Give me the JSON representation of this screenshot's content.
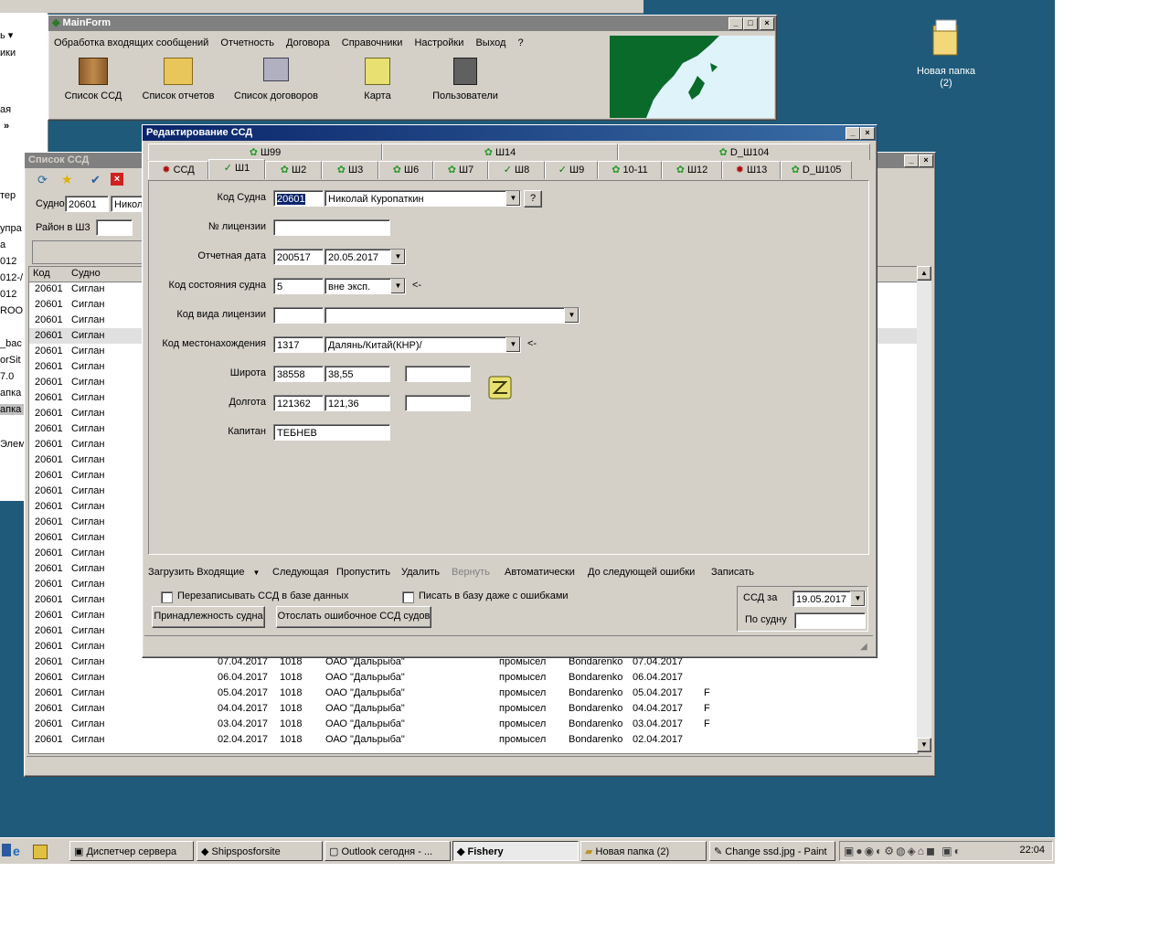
{
  "desktop": {
    "folder_label": "Новая папка (2)"
  },
  "bg_window": {
    "left_fragments": [
      "ь ▾",
      "ики",
      "ая",
      "»",
      "тер",
      "упра",
      "а",
      "012",
      "012-/",
      "012",
      "ROO",
      "_bac",
      "orSit",
      "7.0",
      "апка",
      "апка",
      "Элем"
    ]
  },
  "mainform": {
    "title": "MainForm",
    "menu": [
      "Обработка входящих сообщений",
      "Отчетность",
      "Договора",
      "Справочники",
      "Настройки",
      "Выход",
      "?"
    ],
    "toolbar": [
      {
        "label": "Список ССД",
        "icon": "books-icon"
      },
      {
        "label": "Список отчетов",
        "icon": "folder-icon"
      },
      {
        "label": "Список договоров",
        "icon": "printer-icon"
      },
      {
        "label": "Карта",
        "icon": "map-scroll-icon"
      },
      {
        "label": "Пользователи",
        "icon": "notebook-icon"
      }
    ]
  },
  "ssd_list": {
    "title": "Список ССД",
    "sudno_label": "Судно",
    "sudno_code": "20601",
    "sudno_name": "Никол",
    "rayon_label": "Район в Ш3",
    "columns": [
      "Код",
      "Судно"
    ],
    "rows": [
      {
        "code": "20601",
        "name": "Сиглан",
        "date": "",
        "n": "",
        "org": "",
        "type": "",
        "user": "",
        "date2": "",
        "flag": ""
      },
      {
        "code": "20601",
        "name": "Сиглан",
        "date": "",
        "n": "",
        "org": "",
        "type": "",
        "user": "",
        "date2": "",
        "flag": ""
      },
      {
        "code": "20601",
        "name": "Сиглан",
        "date": "",
        "n": "",
        "org": "",
        "type": "",
        "user": "",
        "date2": "",
        "flag": ""
      },
      {
        "code": "20601",
        "name": "Сиглан",
        "date": "",
        "n": "",
        "org": "",
        "type": "",
        "user": "",
        "date2": "",
        "flag": ""
      },
      {
        "code": "20601",
        "name": "Сиглан",
        "date": "",
        "n": "",
        "org": "",
        "type": "",
        "user": "",
        "date2": "",
        "flag": ""
      },
      {
        "code": "20601",
        "name": "Сиглан",
        "date": "",
        "n": "",
        "org": "",
        "type": "",
        "user": "",
        "date2": "",
        "flag": ""
      },
      {
        "code": "20601",
        "name": "Сиглан",
        "date": "",
        "n": "",
        "org": "",
        "type": "",
        "user": "",
        "date2": "",
        "flag": ""
      },
      {
        "code": "20601",
        "name": "Сиглан",
        "date": "",
        "n": "",
        "org": "",
        "type": "",
        "user": "",
        "date2": "",
        "flag": ""
      },
      {
        "code": "20601",
        "name": "Сиглан",
        "date": "",
        "n": "",
        "org": "",
        "type": "",
        "user": "",
        "date2": "",
        "flag": ""
      },
      {
        "code": "20601",
        "name": "Сиглан",
        "date": "",
        "n": "",
        "org": "",
        "type": "",
        "user": "",
        "date2": "",
        "flag": ""
      },
      {
        "code": "20601",
        "name": "Сиглан",
        "date": "",
        "n": "",
        "org": "",
        "type": "",
        "user": "",
        "date2": "",
        "flag": ""
      },
      {
        "code": "20601",
        "name": "Сиглан",
        "date": "",
        "n": "",
        "org": "",
        "type": "",
        "user": "",
        "date2": "",
        "flag": ""
      },
      {
        "code": "20601",
        "name": "Сиглан",
        "date": "",
        "n": "",
        "org": "",
        "type": "",
        "user": "",
        "date2": "",
        "flag": ""
      },
      {
        "code": "20601",
        "name": "Сиглан",
        "date": "",
        "n": "",
        "org": "",
        "type": "",
        "user": "",
        "date2": "",
        "flag": ""
      },
      {
        "code": "20601",
        "name": "Сиглан",
        "date": "",
        "n": "",
        "org": "",
        "type": "",
        "user": "",
        "date2": "",
        "flag": ""
      },
      {
        "code": "20601",
        "name": "Сиглан",
        "date": "",
        "n": "",
        "org": "",
        "type": "",
        "user": "",
        "date2": "",
        "flag": ""
      },
      {
        "code": "20601",
        "name": "Сиглан",
        "date": "",
        "n": "",
        "org": "",
        "type": "",
        "user": "",
        "date2": "",
        "flag": ""
      },
      {
        "code": "20601",
        "name": "Сиглан",
        "date": "",
        "n": "",
        "org": "",
        "type": "",
        "user": "",
        "date2": "",
        "flag": ""
      },
      {
        "code": "20601",
        "name": "Сиглан",
        "date": "",
        "n": "",
        "org": "",
        "type": "",
        "user": "",
        "date2": "",
        "flag": ""
      },
      {
        "code": "20601",
        "name": "Сиглан",
        "date": "",
        "n": "",
        "org": "",
        "type": "",
        "user": "",
        "date2": "",
        "flag": ""
      },
      {
        "code": "20601",
        "name": "Сиглан",
        "date": "",
        "n": "",
        "org": "",
        "type": "",
        "user": "",
        "date2": "",
        "flag": ""
      },
      {
        "code": "20601",
        "name": "Сиглан",
        "date": "",
        "n": "",
        "org": "",
        "type": "",
        "user": "",
        "date2": "",
        "flag": ""
      },
      {
        "code": "20601",
        "name": "Сиглан",
        "date": "",
        "n": "",
        "org": "",
        "type": "",
        "user": "",
        "date2": "",
        "flag": ""
      },
      {
        "code": "20601",
        "name": "Сиглан",
        "date": "",
        "n": "",
        "org": "",
        "type": "",
        "user": "",
        "date2": "",
        "flag": ""
      },
      {
        "code": "20601",
        "name": "Сиглан",
        "date": "07.04.2017",
        "n": "1018",
        "org": "ОАО \"Дальрыба\"",
        "type": "промысел",
        "user": "Bondarenko",
        "date2": "07.04.2017",
        "flag": ""
      },
      {
        "code": "20601",
        "name": "Сиглан",
        "date": "06.04.2017",
        "n": "1018",
        "org": "ОАО \"Дальрыба\"",
        "type": "промысел",
        "user": "Bondarenko",
        "date2": "06.04.2017",
        "flag": ""
      },
      {
        "code": "20601",
        "name": "Сиглан",
        "date": "05.04.2017",
        "n": "1018",
        "org": "ОАО \"Дальрыба\"",
        "type": "промысел",
        "user": "Bondarenko",
        "date2": "05.04.2017",
        "flag": "F"
      },
      {
        "code": "20601",
        "name": "Сиглан",
        "date": "04.04.2017",
        "n": "1018",
        "org": "ОАО \"Дальрыба\"",
        "type": "промысел",
        "user": "Bondarenko",
        "date2": "04.04.2017",
        "flag": "F"
      },
      {
        "code": "20601",
        "name": "Сиглан",
        "date": "03.04.2017",
        "n": "1018",
        "org": "ОАО \"Дальрыба\"",
        "type": "промысел",
        "user": "Bondarenko",
        "date2": "03.04.2017",
        "flag": "F"
      },
      {
        "code": "20601",
        "name": "Сиглан",
        "date": "02.04.2017",
        "n": "1018",
        "org": "ОАО \"Дальрыба\"",
        "type": "промысел",
        "user": "Bondarenko",
        "date2": "02.04.2017",
        "flag": ""
      }
    ]
  },
  "dialog": {
    "title": "Редактирование ССД",
    "tabs_row1": [
      {
        "label": "Ш99",
        "icon": "gear"
      },
      {
        "label": "Ш14",
        "icon": "gear"
      },
      {
        "label": "D_Ш104",
        "icon": "gear"
      }
    ],
    "tabs_row2": [
      {
        "label": "ССД",
        "icon": "redgear"
      },
      {
        "label": "Ш1",
        "icon": "check"
      },
      {
        "label": "Ш2",
        "icon": "gear"
      },
      {
        "label": "Ш3",
        "icon": "gear"
      },
      {
        "label": "Ш6",
        "icon": "gear"
      },
      {
        "label": "Ш7",
        "icon": "gear"
      },
      {
        "label": "Ш8",
        "icon": "check"
      },
      {
        "label": "Ш9",
        "icon": "check"
      },
      {
        "label": "10-11",
        "icon": "gear"
      },
      {
        "label": "Ш12",
        "icon": "gear"
      },
      {
        "label": "Ш13",
        "icon": "redgear"
      },
      {
        "label": "D_Ш105",
        "icon": "gear"
      }
    ],
    "form": {
      "kod_sudna_label": "Код Судна",
      "kod_sudna": "20601",
      "sudno_name": "Николай Куропаткин",
      "help_btn": "?",
      "license_label": "№ лицензии",
      "license": "",
      "report_date_label": "Отчетная дата",
      "report_date_code": "200517",
      "report_date": "20.05.2017",
      "state_label": "Код состояния судна",
      "state_code": "5",
      "state_name": "вне эксп.",
      "arrow": "<-",
      "license_type_label": "Код вида лицензии",
      "license_type_code": "",
      "license_type_name": "",
      "location_label": "Код местонахождения",
      "location_code": "1317",
      "location_name": "Далянь/Китай(КНР)/",
      "lat_label": "Широта",
      "lat_code": "38558",
      "lat_value": "38,55",
      "lon_label": "Долгота",
      "lon_code": "121362",
      "lon_value": "121,36",
      "captain_label": "Капитан",
      "captain": "ТЕБНЕВ"
    },
    "actions": [
      "Загрузить Входящие",
      "Следующая",
      "Пропустить",
      "Удалить",
      "Вернуть",
      "Автоматически",
      "До следующей ошибки",
      "Записать"
    ],
    "rewrite_label": "Перезаписывать ССД в базе данных",
    "write_errors_label": "Писать в базу даже с ошибками",
    "belong_btn": "Принадлежность судна",
    "send_btn": "Отослать ошибочное ССД судов",
    "ssd_za_label": "ССД за",
    "ssd_za_value": "19.05.2017",
    "po_sudnu_label": "По судну",
    "po_sudnu_value": ""
  },
  "taskbar": {
    "items": [
      "Диспетчер сервера",
      "Shipsposforsite",
      "Outlook сегодня - ...",
      "Fishery",
      "Новая папка (2)",
      "Change ssd.jpg - Paint"
    ],
    "clock": "22:04"
  }
}
